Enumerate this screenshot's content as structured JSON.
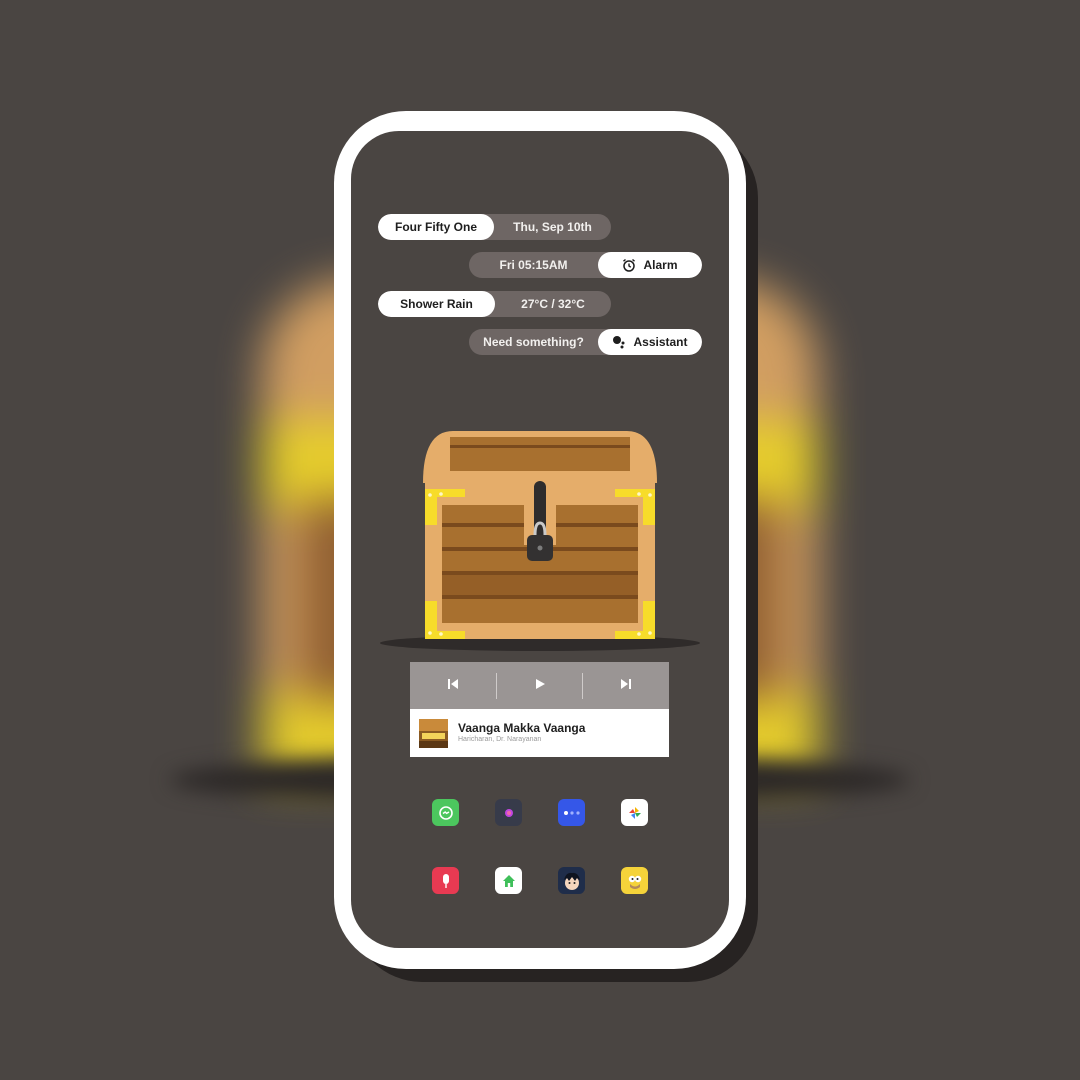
{
  "widgets": {
    "clock_text": "Four Fifty One",
    "date_text": "Thu, Sep 10th",
    "alarm_time": "Fri 05:15AM",
    "alarm_label": "Alarm",
    "weather_condition": "Shower Rain",
    "temperature_range": "27°C / 32°C",
    "assistant_prompt": "Need something?",
    "assistant_label": "Assistant"
  },
  "music_player": {
    "track_title": "Vaanga Makka Vaanga",
    "track_artist": "Haricharan, Dr. Narayanan",
    "controls": [
      "previous-icon",
      "play-icon",
      "next-icon"
    ]
  },
  "app_icons": [
    {
      "name": "messages-app-icon",
      "color": "#4cc65e"
    },
    {
      "name": "camera-app-icon",
      "color": "#373b4a"
    },
    {
      "name": "chat-app-icon",
      "color": "#3557e8"
    },
    {
      "name": "photos-app-icon",
      "color": "#ffffff"
    },
    {
      "name": "recorder-app-icon",
      "color": "#e83a52"
    },
    {
      "name": "home-app-icon",
      "color": "#ffffff"
    },
    {
      "name": "anime-boy-app-icon",
      "color": "#1f2d4a"
    },
    {
      "name": "homer-app-icon",
      "color": "#f5d33a"
    }
  ],
  "colors": {
    "background": "#4a4542",
    "pill_grey": "#6e6664",
    "chest_wood": "#a8702f",
    "chest_trim": "#e5ad6a",
    "chest_gold": "#f7dc2a"
  }
}
